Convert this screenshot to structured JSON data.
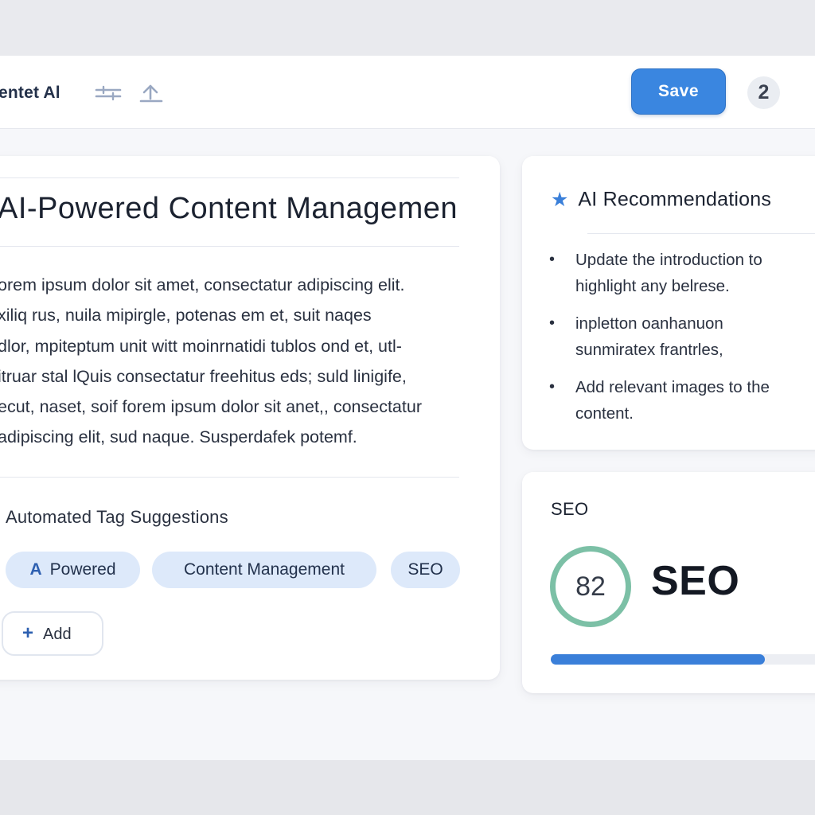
{
  "app": {
    "brand": "entet Al"
  },
  "toolbar": {
    "save_label": "Save",
    "notification_count": "2"
  },
  "editor": {
    "title": "AI-Powered Content Managemen",
    "body_lines": [
      "orem ipsum dolor sit amet, consectatur adipiscing elit.",
      "xiliq rus, nuila mipirgle, potenas em et, suit naqes",
      "dlor, mpiteptum unit witt moinrnatidi tublos ond et, utl-",
      "itruar stal lQuis consectatur freehitus eds; suld linigife,",
      "ecut, naset, soif forem ipsum dolor sit anet,, consectatur",
      "adipiscing elit, sud naque. Susperdafek potemf."
    ],
    "tags_heading": "Automated Tag Suggestions",
    "tags": [
      {
        "glyph": "A",
        "label": "Powered"
      },
      {
        "label": "Content Management"
      },
      {
        "label": "SEO"
      }
    ],
    "add_label": "Add"
  },
  "recommendations": {
    "title": "AI Recommendations",
    "items": [
      "Update the introduction to highlight any belrese.",
      "inpletton oanhanuon sunmiratex frantrles,",
      "Add relevant images to the content."
    ]
  },
  "seo": {
    "label": "SEO",
    "score": "82",
    "big_label": "SEO",
    "progress_percent": 79
  },
  "colors": {
    "accent": "#3a86e0",
    "ring": "#7cc0a6",
    "tag_bg": "#dde9fa",
    "progress": "#3a7fd9"
  },
  "icons": [
    "sliders-icon",
    "upload-icon",
    "star-icon",
    "plus-icon"
  ]
}
